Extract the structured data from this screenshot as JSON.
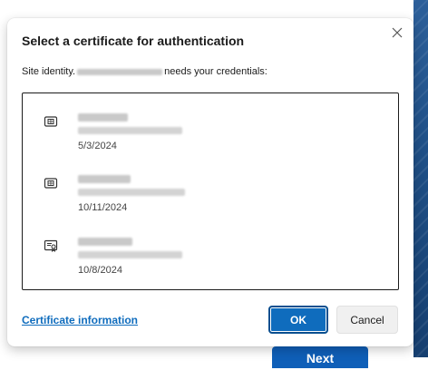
{
  "background": {
    "button_label": "Next"
  },
  "dialog": {
    "title": "Select a certificate for authentication",
    "site_prefix": "Site identity.",
    "site_suffix": " needs your credentials:",
    "certificates": [
      {
        "icon": "smartcard-chip-icon",
        "date": "5/3/2024"
      },
      {
        "icon": "smartcard-chip-icon",
        "date": "10/11/2024"
      },
      {
        "icon": "certificate-document-icon",
        "date": "10/8/2024"
      }
    ],
    "certificate_info_link": "Certificate information",
    "ok_label": "OK",
    "cancel_label": "Cancel"
  },
  "colors": {
    "accent": "#0f6cbd",
    "backdrop": "#1f4f86"
  }
}
